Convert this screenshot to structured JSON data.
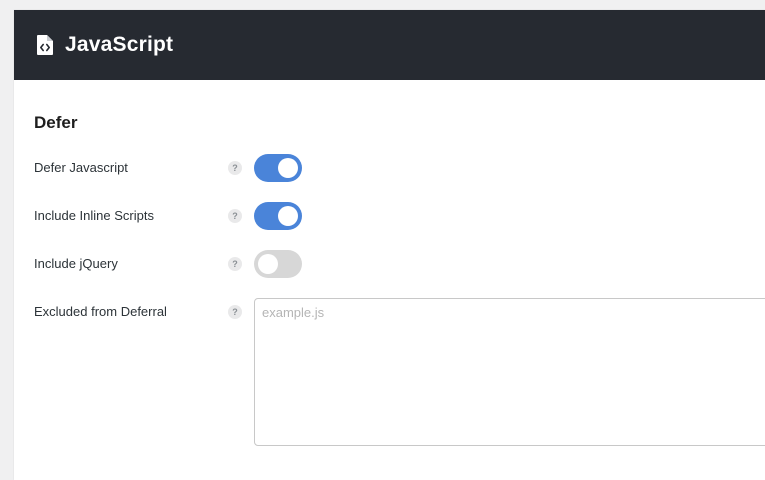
{
  "header": {
    "title": "JavaScript",
    "icon": "file-code-icon"
  },
  "section": {
    "title": "Defer"
  },
  "settings": [
    {
      "label": "Defer Javascript",
      "help": "?",
      "enabled": true
    },
    {
      "label": "Include Inline Scripts",
      "help": "?",
      "enabled": true
    },
    {
      "label": "Include jQuery",
      "help": "?",
      "enabled": false
    }
  ],
  "excluded": {
    "label": "Excluded from Deferral",
    "help": "?",
    "placeholder": "example.js",
    "value": ""
  },
  "colors": {
    "header_bg": "#262a31",
    "toggle_on": "#4a84d9",
    "toggle_off": "#d7d7d7"
  }
}
